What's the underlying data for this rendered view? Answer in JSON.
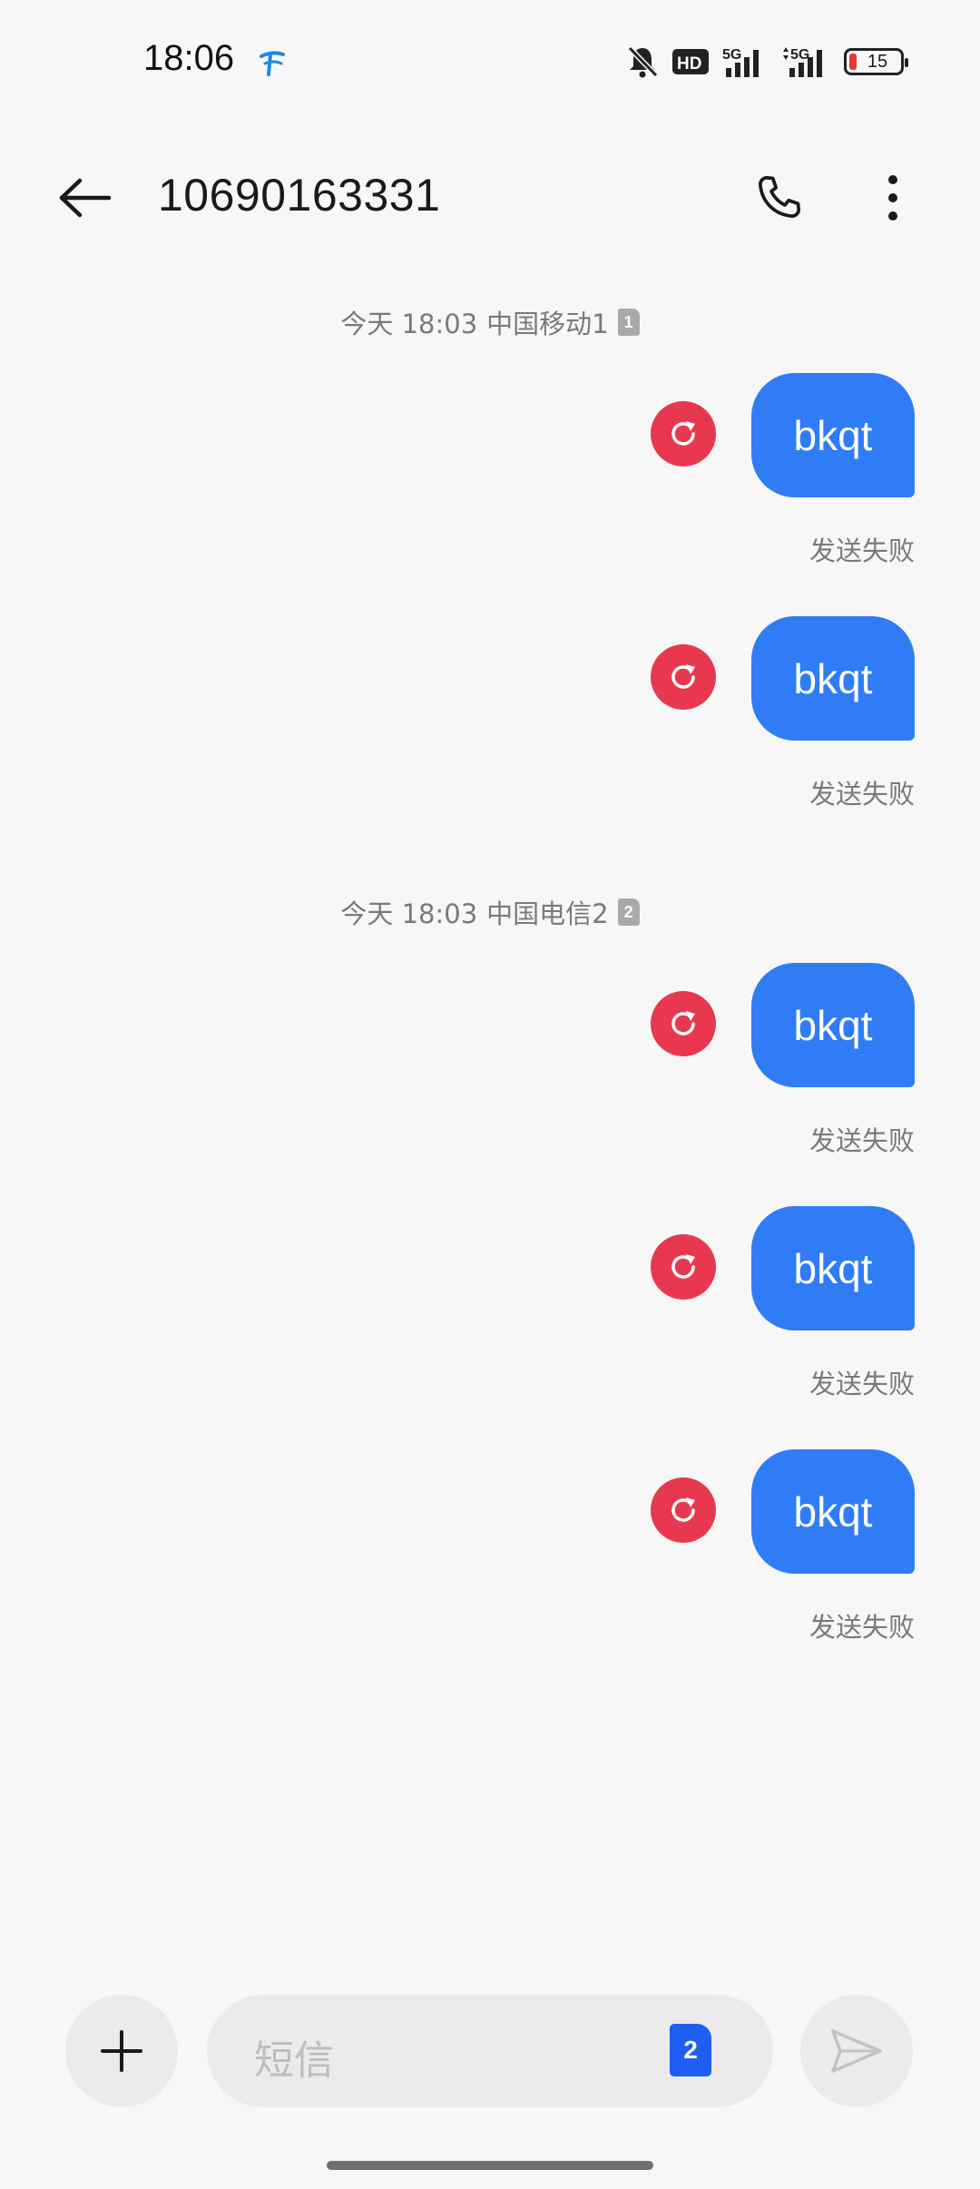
{
  "status_bar": {
    "time": "18:06",
    "battery_level": "15",
    "icons": [
      "carrier-logo-icon",
      "mute-bell-icon",
      "hd-icon",
      "5g-signal-icon",
      "5g-signal-icon",
      "battery-icon"
    ]
  },
  "header": {
    "title": "10690163331",
    "back_icon": "arrow-left-icon",
    "call_icon": "phone-icon",
    "more_icon": "more-vertical-icon"
  },
  "groups": [
    {
      "time": "今天 18:03",
      "sim_name": "中国移动1",
      "sim_badge": "1",
      "messages": [
        {
          "text": "bkqt",
          "status": "发送失败"
        },
        {
          "text": "bkqt",
          "status": "发送失败"
        }
      ]
    },
    {
      "time": "今天 18:03",
      "sim_name": "中国电信2",
      "sim_badge": "2",
      "messages": [
        {
          "text": "bkqt",
          "status": "发送失败"
        },
        {
          "text": "bkqt",
          "status": "发送失败"
        },
        {
          "text": "bkqt",
          "status": "发送失败"
        }
      ]
    }
  ],
  "composer": {
    "placeholder": "短信",
    "sim_selected": "2",
    "add_icon": "plus-icon",
    "send_icon": "send-icon"
  },
  "colors": {
    "bubble": "#2f7cf6",
    "retry": "#e8384f",
    "sim_select": "#1e5ef2",
    "background": "#f7f7f7"
  }
}
